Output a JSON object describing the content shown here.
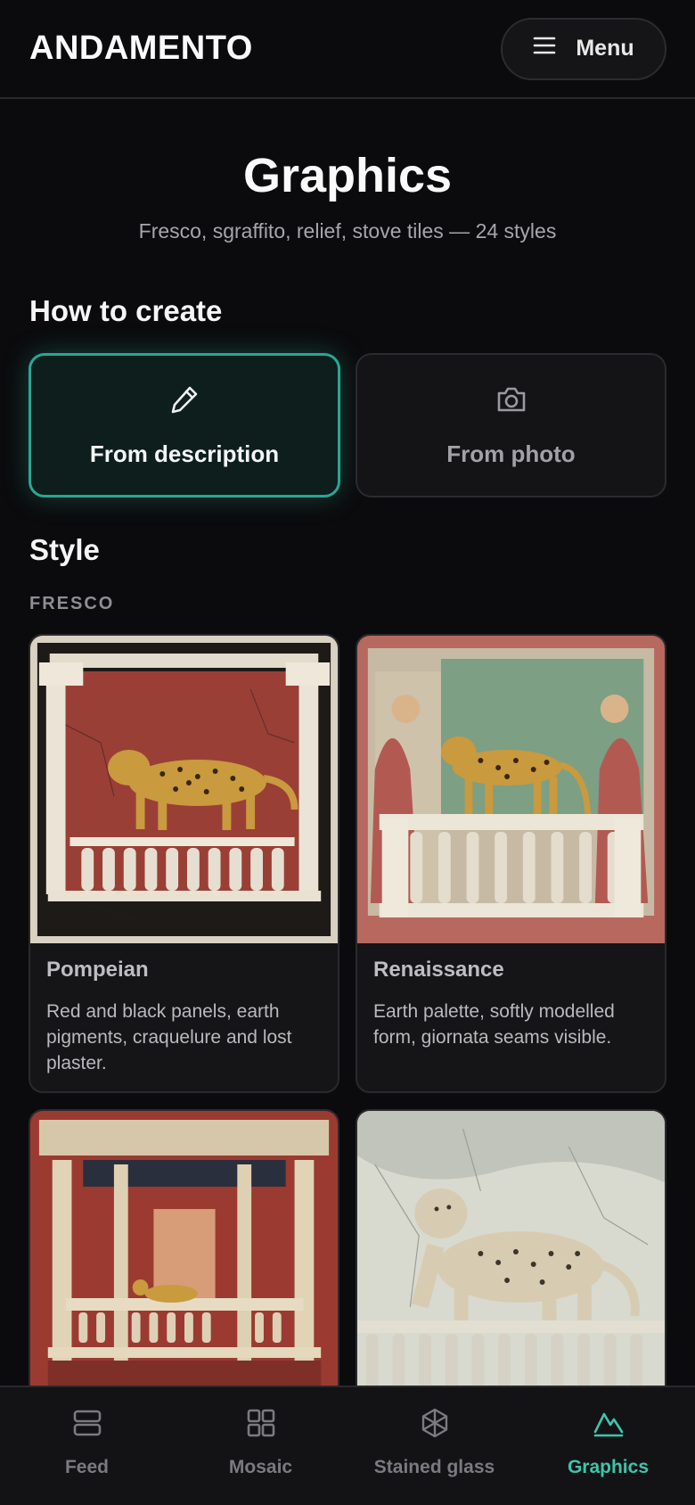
{
  "header": {
    "brand": "ANDAMENTO",
    "menu_label": "Menu",
    "menu_icon": "hamburger-icon"
  },
  "hero": {
    "title": "Graphics",
    "subtitle": "Fresco, sgraffito, relief, stove tiles — 24 styles"
  },
  "create": {
    "heading": "How to create",
    "options": [
      {
        "label": "From description",
        "icon": "pencil-icon",
        "selected": true
      },
      {
        "label": "From photo",
        "icon": "camera-icon",
        "selected": false
      }
    ]
  },
  "style": {
    "heading": "Style",
    "group_label": "FRESCO",
    "cards": [
      {
        "name": "Pompeian",
        "description": "Red and black panels, earth pigments, craquelure and lost plaster."
      },
      {
        "name": "Renaissance",
        "description": "Earth palette, softly modelled form, giornata seams visible."
      },
      {
        "name": "",
        "description": ""
      },
      {
        "name": "",
        "description": ""
      }
    ]
  },
  "tabbar": {
    "items": [
      {
        "label": "Feed",
        "icon": "feed-icon",
        "active": false
      },
      {
        "label": "Mosaic",
        "icon": "grid-icon",
        "active": false
      },
      {
        "label": "Stained glass",
        "icon": "stained-glass-icon",
        "active": false
      },
      {
        "label": "Graphics",
        "icon": "mountain-icon",
        "active": true
      }
    ]
  },
  "colors": {
    "accent": "#2aa693",
    "accent_text": "#3fc4ad",
    "background": "#0b0b0d",
    "surface": "#151517"
  }
}
